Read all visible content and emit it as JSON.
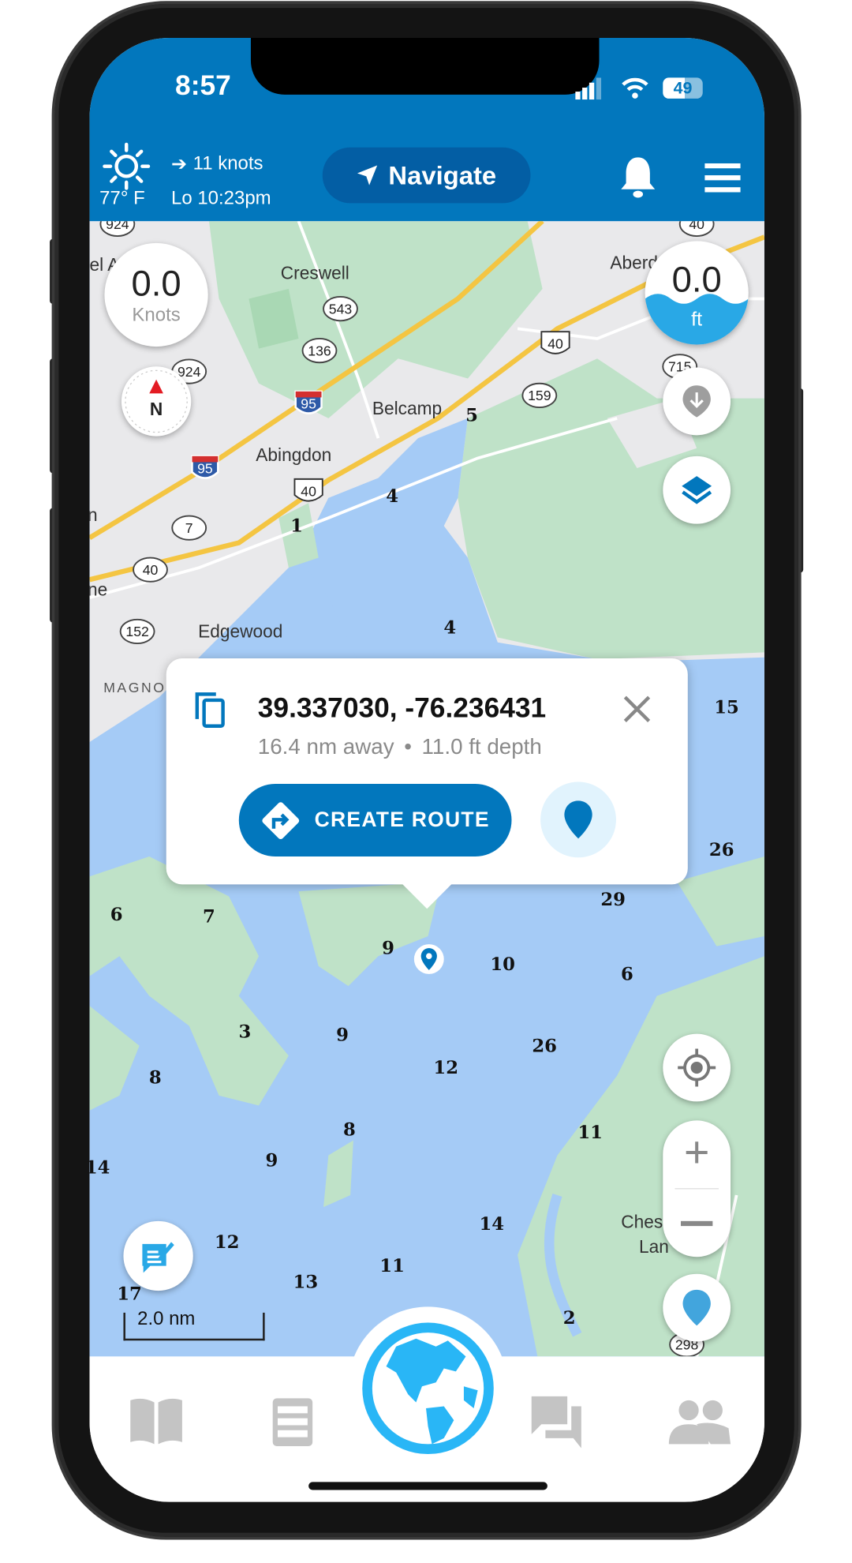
{
  "status_bar": {
    "time": "8:57",
    "battery": "49"
  },
  "header": {
    "weather_icon": "sun-icon",
    "temperature": "77° F",
    "wind": "11 knots",
    "tide": "Lo 10:23pm",
    "navigate_label": "Navigate",
    "accent_color": "#0277bd"
  },
  "map": {
    "speed_value": "0.0",
    "speed_unit": "Knots",
    "compass_label": "N",
    "depth_value": "0.0",
    "depth_unit": "ft",
    "scale_label": "2.0 nm",
    "places": [
      "Creswell",
      "Belcamp",
      "Abingdon",
      "Edgewood",
      "MAGNO",
      "Aberd",
      "el A",
      "Ches",
      "Lan",
      "n",
      "ne"
    ],
    "road_shields": [
      "924",
      "543",
      "136",
      "95",
      "924",
      "95",
      "40",
      "7",
      "40",
      "152",
      "40",
      "159",
      "715",
      "40",
      "298"
    ],
    "depths": [
      "5",
      "4",
      "1",
      "4",
      "15",
      "26",
      "29",
      "6",
      "7",
      "9",
      "10",
      "6",
      "3",
      "9",
      "26",
      "12",
      "8",
      "8",
      "11",
      "9",
      "14",
      "14",
      "12",
      "11",
      "13",
      "17",
      "2"
    ]
  },
  "popup": {
    "coordinates": "39.337030, -76.236431",
    "distance": "16.4 nm away",
    "separator": "•",
    "depth": "11.0 ft depth",
    "create_route_label": "CREATE ROUTE"
  },
  "bottom_nav": {
    "items": [
      "book-icon",
      "list-icon",
      "globe-icon",
      "chat-icon",
      "people-icon"
    ],
    "active": "globe-icon",
    "active_color": "#29b6f6"
  }
}
